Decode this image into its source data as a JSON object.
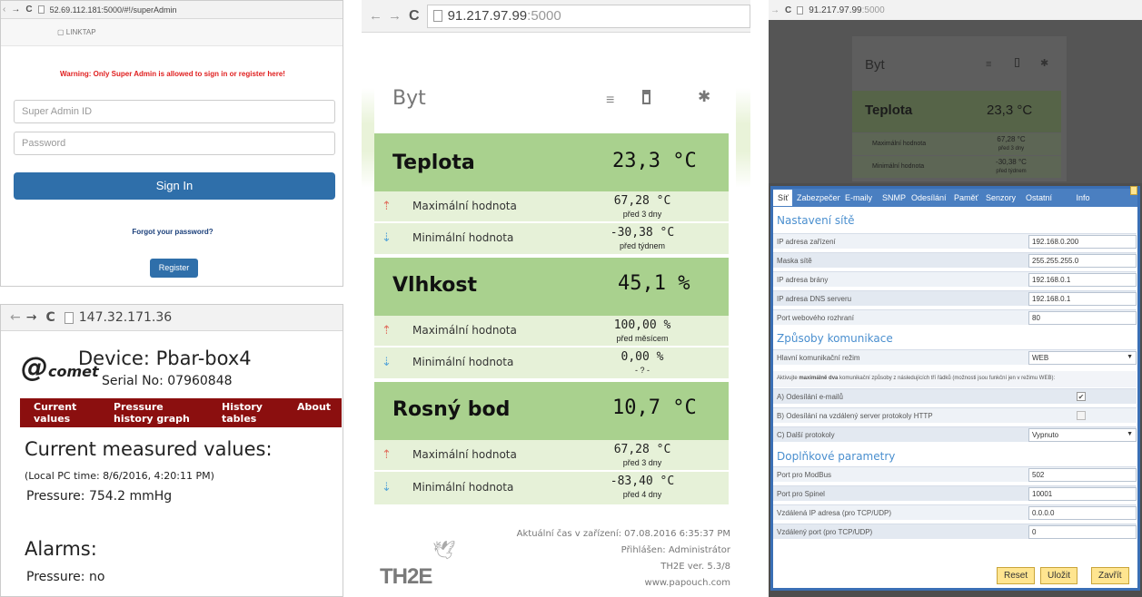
{
  "panel1": {
    "url": "52.69.112.181:5000/#!/superAdmin",
    "brand": "LINKTAP",
    "warning": "Warning: Only Super Admin is allowed to sign in or register here!",
    "admin_id_placeholder": "Super Admin ID",
    "password_placeholder": "Password",
    "sign_in": "Sign In",
    "forgot": "Forgot your password?",
    "register": "Register"
  },
  "panel2": {
    "url": "147.32.171.36",
    "logo": "comet",
    "device": "Device: Pbar-box4",
    "serial": "Serial No: 07960848",
    "nav": [
      {
        "line1": "Current",
        "line2": "values"
      },
      {
        "line1": "Pressure",
        "line2": "history graph"
      },
      {
        "line1": "History",
        "line2": "tables"
      },
      {
        "line1": "About",
        "line2": ""
      }
    ],
    "heading": "Current measured values:",
    "local_time": "(Local PC time: 8/6/2016, 4:20:11 PM)",
    "pressure": "Pressure: 754.2 mmHg",
    "alarms": "Alarms:",
    "alarm_pressure": "Pressure: no"
  },
  "panel3": {
    "url_main": "91.217.97.99",
    "url_port": ":5000",
    "title": "Byt",
    "sections": [
      {
        "name": "Teplota",
        "value": "23,3 °C",
        "max_label": "Maximální hodnota",
        "max_value": "67,28 °C",
        "max_when": "před 3 dny",
        "min_label": "Minimální hodnota",
        "min_value": "-30,38 °C",
        "min_when": "před týdnem"
      },
      {
        "name": "Vlhkost",
        "value": "45,1 %",
        "max_label": "Maximální hodnota",
        "max_value": "100,00 %",
        "max_when": "před měsícem",
        "min_label": "Minimální hodnota",
        "min_value": "0,00 %",
        "min_when": "- ? -"
      },
      {
        "name": "Rosný bod",
        "value": "10,7 °C",
        "max_label": "Maximální hodnota",
        "max_value": "67,28 °C",
        "max_when": "před 3 dny",
        "min_label": "Minimální hodnota",
        "min_value": "-83,40 °C",
        "min_when": "před 4 dny"
      }
    ],
    "footer": {
      "time": "Aktuální čas v zařízení: 07.08.2016 6:35:37 PM",
      "user": "Přihlášen: Administrátor",
      "version": "TH2E ver. 5.3/8",
      "site": "www.papouch.com",
      "logo": "TH2E"
    }
  },
  "panel4": {
    "url_main": "91.217.97.99",
    "url_port": ":5000",
    "bg_title": "Byt",
    "bg_name": "Teplota",
    "bg_value": "23,3 °C",
    "bg_max_label": "Maximální hodnota",
    "bg_max_value": "67,28 °C",
    "bg_max_when": "před 3 dny",
    "bg_min_label": "Minimální hodnota",
    "bg_min_value": "-30,38 °C",
    "bg_min_when": "před týdnem",
    "tabs": [
      "Síť",
      "Zabezpečení",
      "E-maily",
      "SNMP",
      "Odesílání",
      "Paměť",
      "Senzory",
      "Ostatní",
      "Info"
    ],
    "network_title": "Nastavení sítě",
    "network": [
      {
        "label": "IP adresa zařízení",
        "value": "192.168.0.200"
      },
      {
        "label": "Maska sítě",
        "value": "255.255.255.0"
      },
      {
        "label": "IP adresa brány",
        "value": "192.168.0.1"
      },
      {
        "label": "IP adresa DNS serveru",
        "value": "192.168.0.1"
      },
      {
        "label": "Port webového rozhraní",
        "value": "80"
      }
    ],
    "comm_title": "Způsoby komunikace",
    "comm_label": "Hlavní komunikační režim",
    "comm_value": "WEB",
    "note_pre": "Aktivujte ",
    "note_bold": "maximálně dva",
    "note_post": " komunikační způsoby z následujících tří řádků (možnosti jsou funkční jen v režimu WEB):",
    "opt_a": "A) Odesílání e-mailů",
    "opt_a_checked": true,
    "opt_b": "B) Odesílání na vzdálený server protokoly HTTP",
    "opt_b_checked": false,
    "opt_c": "C) Další protokoly",
    "opt_c_value": "Vypnuto",
    "extra_title": "Doplňkové parametry",
    "extra": [
      {
        "label": "Port pro ModBus",
        "value": "502"
      },
      {
        "label": "Port pro Spinel",
        "value": "10001"
      },
      {
        "label": "Vzdálená IP adresa (pro TCP/UDP)",
        "value": "0.0.0.0"
      },
      {
        "label": "Vzdálený port (pro TCP/UDP)",
        "value": "0"
      }
    ],
    "reset": "Reset",
    "save": "Uložit",
    "close": "Zavřít"
  }
}
